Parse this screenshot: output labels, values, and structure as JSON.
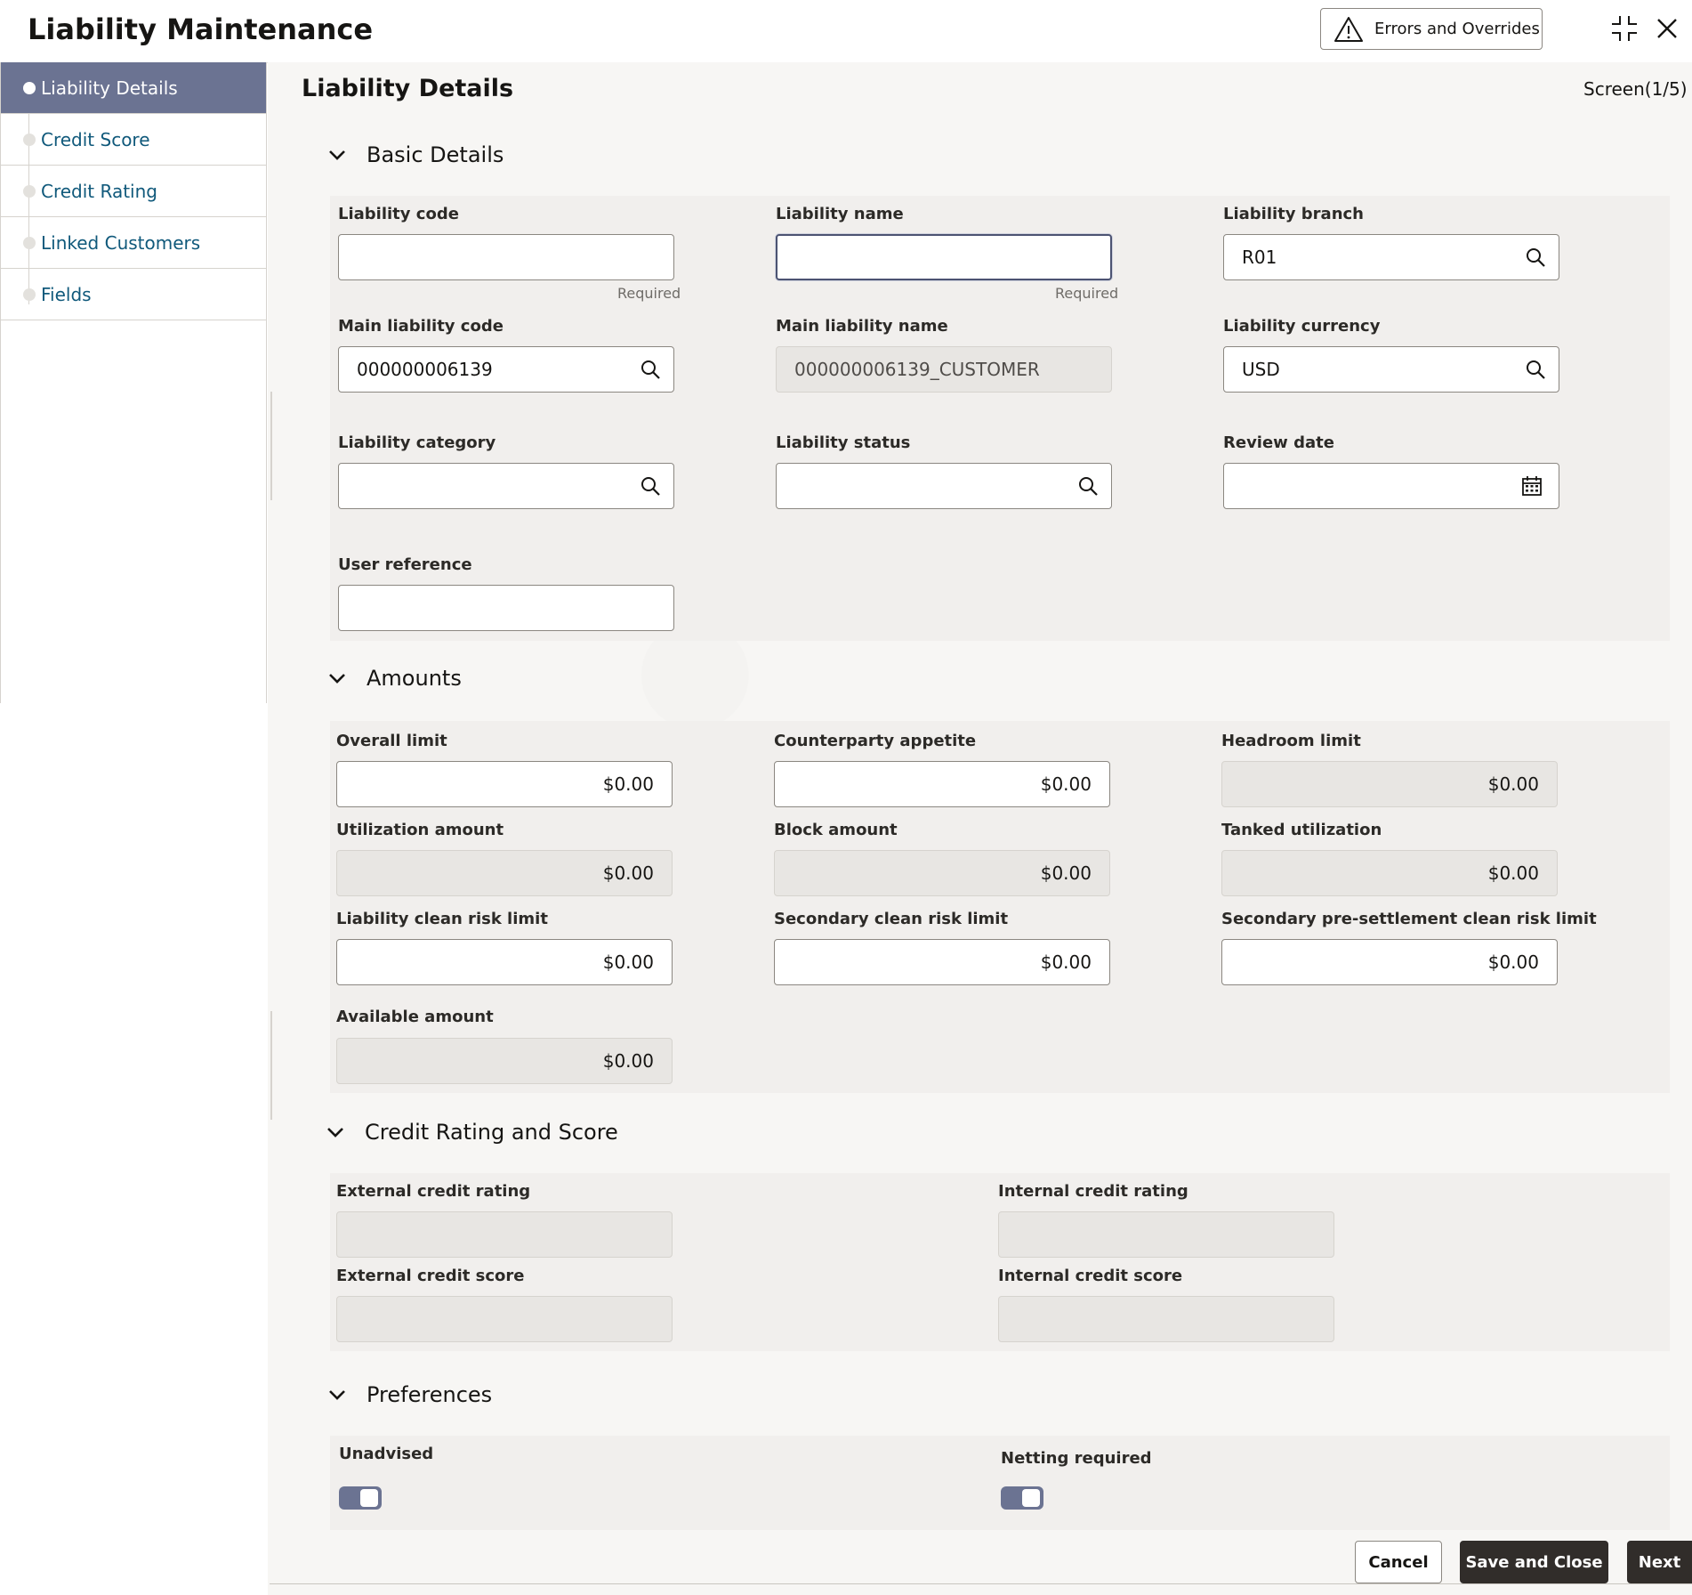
{
  "header": {
    "title": "Liability Maintenance",
    "errors_button": "Errors and Overrides"
  },
  "sidebar": {
    "items": [
      {
        "label": "Liability Details",
        "active": true
      },
      {
        "label": "Credit Score"
      },
      {
        "label": "Credit Rating"
      },
      {
        "label": "Linked Customers"
      },
      {
        "label": "Fields"
      }
    ]
  },
  "page": {
    "title": "Liability Details",
    "screen_indicator": "Screen(1/5)"
  },
  "basic_details": {
    "title": "Basic Details",
    "liability_code": {
      "label": "Liability code",
      "value": "",
      "hint": "Required"
    },
    "liability_name": {
      "label": "Liability name",
      "value": "",
      "hint": "Required"
    },
    "liability_branch": {
      "label": "Liability branch",
      "value": "R01"
    },
    "main_liability_code": {
      "label": "Main liability code",
      "value": "000000006139"
    },
    "main_liability_name": {
      "label": "Main liability name",
      "value": "000000006139_CUSTOMER"
    },
    "liability_currency": {
      "label": "Liability currency",
      "value": "USD"
    },
    "liability_category": {
      "label": "Liability category",
      "value": ""
    },
    "liability_status": {
      "label": "Liability status",
      "value": ""
    },
    "review_date": {
      "label": "Review date",
      "value": ""
    },
    "user_reference": {
      "label": "User reference",
      "value": ""
    }
  },
  "amounts": {
    "title": "Amounts",
    "overall_limit": {
      "label": "Overall limit",
      "value": "$0.00"
    },
    "counterparty_appetite": {
      "label": "Counterparty appetite",
      "value": "$0.00"
    },
    "headroom_limit": {
      "label": "Headroom limit",
      "value": "$0.00"
    },
    "utilization_amount": {
      "label": "Utilization amount",
      "value": "$0.00"
    },
    "block_amount": {
      "label": "Block amount",
      "value": "$0.00"
    },
    "tanked_utilization": {
      "label": "Tanked utilization",
      "value": "$0.00"
    },
    "liability_clean_risk_limit": {
      "label": "Liability clean risk limit",
      "value": "$0.00"
    },
    "secondary_clean_risk_limit": {
      "label": "Secondary clean risk limit",
      "value": "$0.00"
    },
    "secondary_presettlement_limit": {
      "label": "Secondary pre-settlement clean risk limit",
      "value": "$0.00"
    },
    "available_amount": {
      "label": "Available amount",
      "value": "$0.00"
    }
  },
  "credit": {
    "title": "Credit Rating and Score",
    "external_rating": {
      "label": "External credit rating",
      "value": ""
    },
    "internal_rating": {
      "label": "Internal credit rating",
      "value": ""
    },
    "external_score": {
      "label": "External credit score",
      "value": ""
    },
    "internal_score": {
      "label": "Internal credit score",
      "value": ""
    }
  },
  "preferences": {
    "title": "Preferences",
    "unadvised": {
      "label": "Unadvised",
      "on": true
    },
    "netting_required": {
      "label": "Netting required",
      "on": true
    }
  },
  "footer": {
    "cancel": "Cancel",
    "save_close": "Save and Close",
    "next": "Next"
  },
  "colors": {
    "nav_active": "#6b7392",
    "nav_link": "#10597b",
    "primary_button": "#312d2a",
    "toggle_on": "#6b7392"
  },
  "icons": [
    "warning-icon",
    "compress-icon",
    "close-icon",
    "search-icon",
    "calendar-icon",
    "chevron-down-icon"
  ]
}
